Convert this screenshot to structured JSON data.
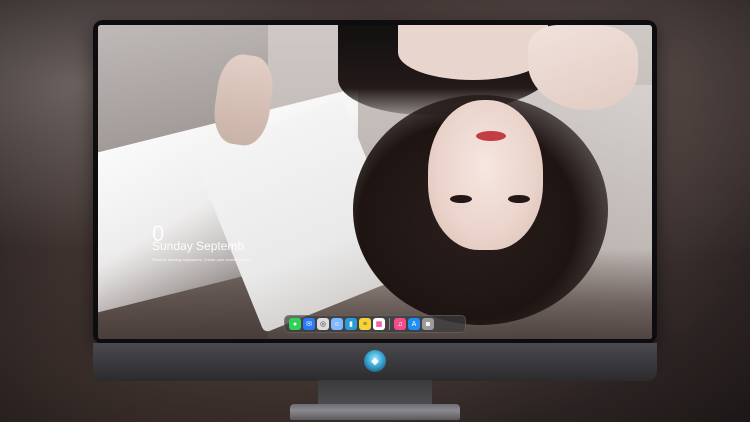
{
  "lock_screen": {
    "time": "0",
    "date": "Sunday Septemb",
    "hint": "Resume sharing wallpapers, Create your screen sense..."
  },
  "dock": {
    "apps": [
      {
        "name": "Messages",
        "icon": "messages-icon",
        "glyph": "●",
        "color": "#2fd158"
      },
      {
        "name": "Mail",
        "icon": "mail-icon",
        "glyph": "✉",
        "color": "#2a7bf4"
      },
      {
        "name": "Safari",
        "icon": "safari-icon",
        "glyph": "◎",
        "color": "#dddddd"
      },
      {
        "name": "Finder",
        "icon": "finder-icon",
        "glyph": "☺",
        "color": "#7fb9ff"
      },
      {
        "name": "Claquette",
        "icon": "movie-icon",
        "glyph": "▮",
        "color": "#2b9bd8"
      },
      {
        "name": "Notes",
        "icon": "notes-icon",
        "glyph": "≡",
        "color": "#f5d33b"
      },
      {
        "name": "Photos",
        "icon": "photos-icon",
        "glyph": "▦",
        "color": "#ffffff"
      },
      {
        "name": "Music",
        "icon": "music-icon",
        "glyph": "♫",
        "color": "#f04e8c"
      },
      {
        "name": "App Store",
        "icon": "app-store-icon",
        "glyph": "A",
        "color": "#1f8ff5"
      },
      {
        "name": "Camera",
        "icon": "camera-icon",
        "glyph": "◙",
        "color": "#9a9a9a"
      }
    ]
  },
  "monitor": {
    "logo_icon": "robot-logo-icon"
  }
}
